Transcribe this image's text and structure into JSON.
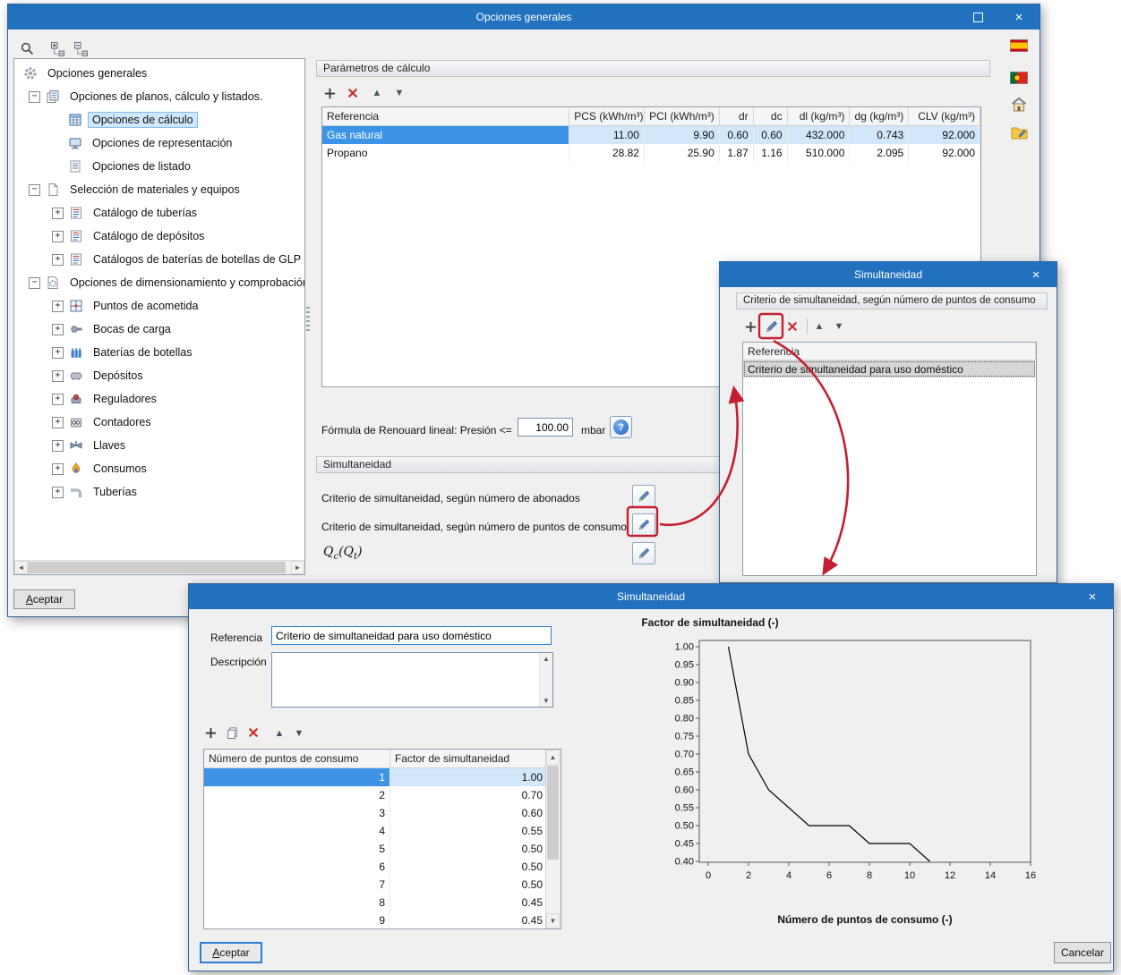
{
  "main_window": {
    "title": "Opciones generales",
    "controls": {
      "close": "×"
    },
    "toolbar": {
      "icons": [
        "search-icon",
        "expand-all-icon",
        "collapse-all-icon"
      ]
    },
    "side_icons": [
      "spain-flag-icon",
      "portugal-flag-icon",
      "home-icon",
      "folder-edit-icon"
    ],
    "accept_label": "Aceptar",
    "tree": {
      "items": [
        {
          "label": "Opciones generales",
          "level": 0,
          "expander": null,
          "icon": "gear"
        },
        {
          "label": "Opciones de planos, cálculo y listados.",
          "level": 1,
          "expander": "minus",
          "icon": "plans"
        },
        {
          "label": "Opciones de cálculo",
          "level": 2,
          "expander": null,
          "icon": "calc",
          "selected": true
        },
        {
          "label": "Opciones de representación",
          "level": 2,
          "expander": null,
          "icon": "repr"
        },
        {
          "label": "Opciones de listado",
          "level": 2,
          "expander": null,
          "icon": "list"
        },
        {
          "label": "Selección de materiales y equipos",
          "level": 1,
          "expander": "minus",
          "icon": "materials"
        },
        {
          "label": "Catálogo de tuberías",
          "level": 2,
          "expander": "plus",
          "icon": "catalog"
        },
        {
          "label": "Catálogo de depósitos",
          "level": 2,
          "expander": "plus",
          "icon": "catalog"
        },
        {
          "label": "Catálogos de baterías de botellas de GLP",
          "level": 2,
          "expander": "plus",
          "icon": "catalog"
        },
        {
          "label": "Opciones de dimensionamiento y comprobación",
          "level": 1,
          "expander": "minus",
          "icon": "dim"
        },
        {
          "label": "Puntos de acometida",
          "level": 2,
          "expander": "plus",
          "icon": "acometida"
        },
        {
          "label": "Bocas de carga",
          "level": 2,
          "expander": "plus",
          "icon": "bocas"
        },
        {
          "label": "Baterías de botellas",
          "level": 2,
          "expander": "plus",
          "icon": "baterias"
        },
        {
          "label": "Depósitos",
          "level": 2,
          "expander": "plus",
          "icon": "depositos"
        },
        {
          "label": "Reguladores",
          "level": 2,
          "expander": "plus",
          "icon": "reguladores"
        },
        {
          "label": "Contadores",
          "level": 2,
          "expander": "plus",
          "icon": "contadores"
        },
        {
          "label": "Llaves",
          "level": 2,
          "expander": "plus",
          "icon": "llaves"
        },
        {
          "label": "Consumos",
          "level": 2,
          "expander": "plus",
          "icon": "consumos"
        },
        {
          "label": "Tuberías",
          "level": 2,
          "expander": "plus",
          "icon": "tuberias"
        }
      ]
    },
    "params": {
      "header": "Parámetros de cálculo",
      "toolbar_icons": [
        "add-icon",
        "delete-icon",
        "move-up-icon",
        "move-down-icon"
      ],
      "columns": [
        "Referencia",
        "PCS (kWh/m³)",
        "PCI (kWh/m³)",
        "dr",
        "dc",
        "dl (kg/m³)",
        "dg (kg/m³)",
        "CLV (kg/m³)"
      ],
      "rows": [
        [
          "Gas natural",
          "11.00",
          "9.90",
          "0.60",
          "0.60",
          "432.000",
          "0.743",
          "92.000"
        ],
        [
          "Propano",
          "28.82",
          "25.90",
          "1.87",
          "1.16",
          "510.000",
          "2.095",
          "92.000"
        ]
      ],
      "selected_row": 0,
      "formula_label": "Fórmula de Renouard lineal: Presión <=",
      "pressure_value": "100.00",
      "pressure_unit": "mbar"
    },
    "sim_section": {
      "header": "Simultaneidad",
      "row_abonados": "Criterio de simultaneidad, según número de abonados",
      "row_puntos": "Criterio de simultaneidad, según número de puntos de consumo",
      "q_parts": {
        "p1": "Q",
        "s1": "c",
        "p2": "(Q",
        "s2": "t",
        "p3": ")"
      }
    }
  },
  "sim_list_window": {
    "title": "Simultaneidad",
    "controls": {
      "close": "×"
    },
    "header": "Criterio de simultaneidad, según número de puntos de consumo",
    "toolbar_icons": [
      "add-icon",
      "edit-icon",
      "delete-icon",
      "move-up-icon",
      "move-down-icon"
    ],
    "column": "Referencia",
    "rows": [
      "Criterio de simultaneidad para uso doméstico"
    ],
    "selected_row": 0
  },
  "sim_edit_window": {
    "title": "Simultaneidad",
    "controls": {
      "close": "×"
    },
    "referencia_label": "Referencia",
    "referencia_value": "Criterio de simultaneidad para uso doméstico",
    "descripcion_label": "Descripción",
    "descripcion_value": "",
    "toolbar_icons": [
      "add-icon",
      "copy-icon",
      "delete-icon",
      "move-up-icon",
      "move-down-icon"
    ],
    "table": {
      "columns": [
        "Número de puntos de consumo",
        "Factor de simultaneidad"
      ],
      "rows": [
        [
          "1",
          "1.00"
        ],
        [
          "2",
          "0.70"
        ],
        [
          "3",
          "0.60"
        ],
        [
          "4",
          "0.55"
        ],
        [
          "5",
          "0.50"
        ],
        [
          "6",
          "0.50"
        ],
        [
          "7",
          "0.50"
        ],
        [
          "8",
          "0.45"
        ],
        [
          "9",
          "0.45"
        ]
      ],
      "selected_row": 0
    },
    "accept_label": "Aceptar",
    "cancel_label": "Cancelar"
  },
  "chart_data": {
    "type": "line",
    "title": "Factor de simultaneidad (-)",
    "xlabel": "Número de puntos de consumo (-)",
    "ylabel": "",
    "x": [
      1,
      2,
      3,
      4,
      5,
      6,
      7,
      8,
      9,
      10,
      11
    ],
    "y": [
      1.0,
      0.7,
      0.6,
      0.55,
      0.5,
      0.5,
      0.5,
      0.45,
      0.45,
      0.45,
      0.4
    ],
    "xlim": [
      0,
      16
    ],
    "ylim": [
      0.4,
      1.0
    ],
    "xticks": [
      "0",
      "2",
      "4",
      "6",
      "8",
      "10",
      "12",
      "14",
      "16"
    ],
    "yticks": [
      "1.00",
      "0.95",
      "0.90",
      "0.85",
      "0.80",
      "0.75",
      "0.70",
      "0.65",
      "0.60",
      "0.55",
      "0.50",
      "0.45",
      "0.40"
    ],
    "grid": false,
    "legend": "none",
    "line_color": "#000000"
  },
  "annotation_color": "#c41f30"
}
